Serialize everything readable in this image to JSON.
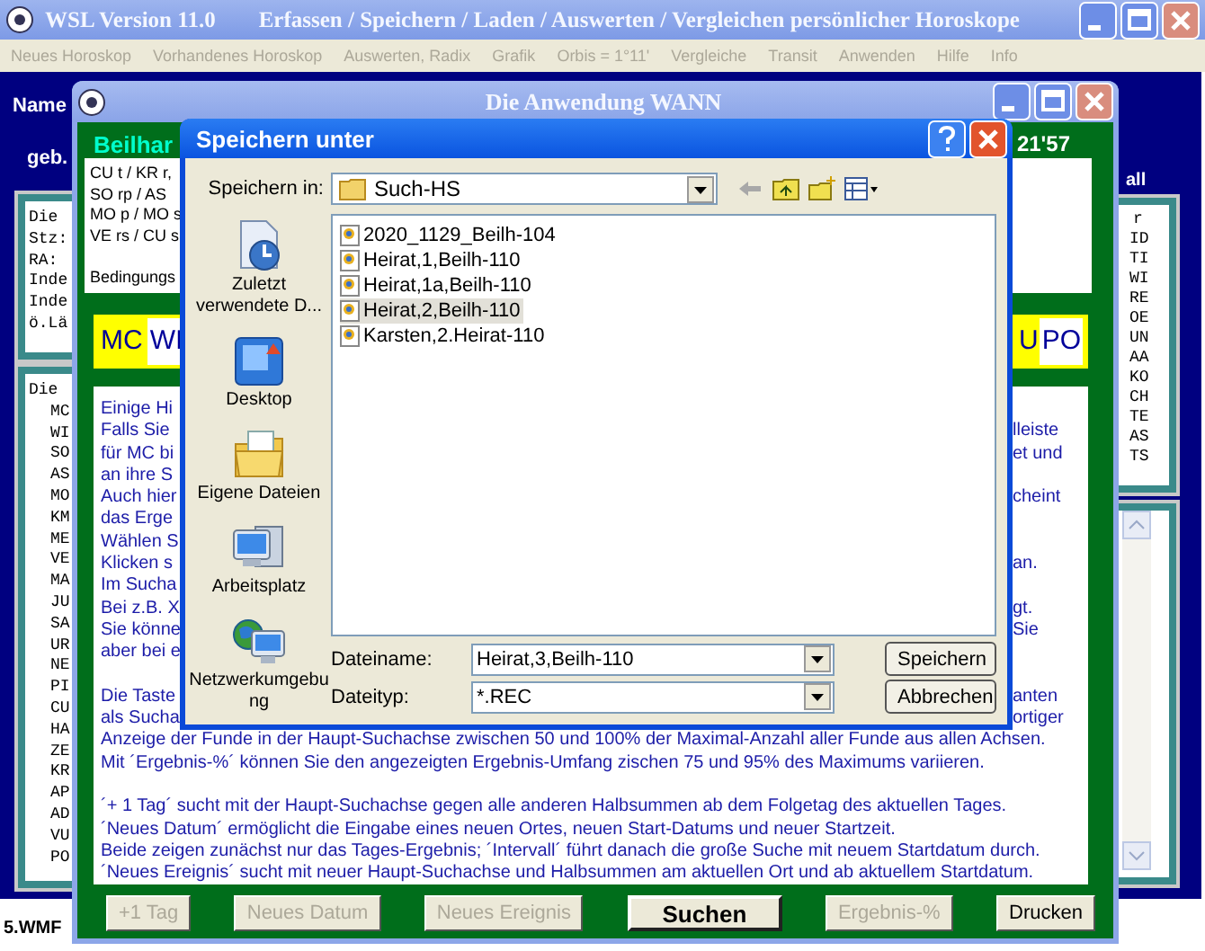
{
  "main_window": {
    "app_name": "WSL Version 11.0",
    "title": "Erfassen / Speichern / Laden / Auswerten / Vergleichen persönlicher Horoskope",
    "menu": [
      {
        "label": "Neues Horoskop",
        "disabled": true
      },
      {
        "label": "Vorhandenes Horoskop",
        "disabled": true
      },
      {
        "label": "Auswerten, Radix",
        "disabled": true
      },
      {
        "label": "Grafik",
        "disabled": true
      },
      {
        "label": "Orbis = 1°11'",
        "disabled": true
      },
      {
        "label": "Vergleiche",
        "disabled": true
      },
      {
        "label": "Transit",
        "disabled": true
      },
      {
        "label": "Anwenden",
        "disabled": true
      },
      {
        "label": "Hilfe",
        "disabled": true
      },
      {
        "label": "Info",
        "disabled": true
      }
    ],
    "name_label": "Name",
    "birth_label": "geb.",
    "left_panel_1": [
      "Die",
      "Stz:",
      "RA:",
      "Inde",
      "Inde",
      "ö.Lä"
    ],
    "left_panel_2": {
      "heading": "Die",
      "rows": [
        "MC",
        "WI",
        "SO",
        "AS",
        "MO",
        "KM",
        "ME",
        "VE",
        "MA",
        "JU",
        "SA",
        "UR",
        "NE",
        "PI",
        "CU",
        "HA",
        "ZE",
        "KR",
        "AP",
        "AD",
        "VU",
        "PO"
      ]
    },
    "right_label": "all",
    "right_panel": [
      "r",
      "ID",
      "TI",
      "WI",
      "RE",
      "OE",
      "UN",
      "AA",
      "KO",
      "CH",
      "TE",
      "AS",
      "TS"
    ],
    "footer_file": "5.WMF"
  },
  "wann_window": {
    "title": "Die Anwendung WANN",
    "name": "Beilhar",
    "time": "21'57",
    "conditions": [
      "CU t / KR r,",
      "SO rp / AS",
      "MO p / MO s",
      "VE rs / CU s"
    ],
    "conditions_footer": "Bedingungs",
    "axes_left": [
      {
        "label": "MC",
        "highlighted": false
      },
      {
        "label": "WI",
        "highlighted": true
      }
    ],
    "axes_right": [
      {
        "label": "U",
        "highlighted": false
      },
      {
        "label": "PO",
        "highlighted": true
      }
    ],
    "help_lines": [
      {
        "kind": "split",
        "left": "Einige Hi"
      },
      {
        "kind": "split",
        "left": "Falls Sie",
        "right": "lleiste"
      },
      {
        "kind": "split",
        "left": "für MC bi",
        "right": "et und"
      },
      {
        "kind": "split",
        "left": "an ihre S"
      },
      {
        "kind": "split",
        "left": "Auch hier",
        "right": "cheint"
      },
      {
        "kind": "split",
        "left": "das Erge"
      },
      {
        "kind": "split",
        "left": "Wählen S"
      },
      {
        "kind": "split",
        "left": "Klicken s",
        "right": "an."
      },
      {
        "kind": "split",
        "left": "Im Sucha"
      },
      {
        "kind": "split",
        "left": "Bei z.B. X",
        "right": "gt."
      },
      {
        "kind": "split",
        "left": "Sie könne",
        "right": "Sie"
      },
      {
        "kind": "split",
        "left": "aber bei e"
      },
      {
        "kind": "blank"
      },
      {
        "kind": "split",
        "left": "Die Taste",
        "right": "anten"
      },
      {
        "kind": "split",
        "left": "als Sucha",
        "right": "ortiger"
      },
      {
        "kind": "full",
        "text": "Anzeige der Funde in der Haupt-Suchachse zwischen 50 und 100% der Maximal-Anzahl aller Funde aus allen Achsen."
      },
      {
        "kind": "full",
        "text": "Mit ´Ergebnis-%´ können Sie den angezeigten Ergebnis-Umfang zischen 75 und 95% des Maximums variieren."
      },
      {
        "kind": "blank"
      },
      {
        "kind": "full",
        "text": "´+ 1 Tag´ sucht mit der Haupt-Suchachse gegen alle anderen Halbsummen ab dem Folgetag des aktuellen Tages."
      },
      {
        "kind": "full",
        "text": "´Neues Datum´ ermöglicht die Eingabe eines neuen Ortes, neuen Start-Datums und neuer Startzeit."
      },
      {
        "kind": "full",
        "text": "Beide zeigen zunächst nur das Tages-Ergebnis; ´Intervall´ führt danach die große Suche mit neuem Startdatum durch."
      },
      {
        "kind": "full",
        "text": "´Neues Ereignis´ sucht mit neuer Haupt-Suchachse und Halbsummen am aktuellen Ort und ab aktuellem Startdatum."
      }
    ],
    "buttons": [
      {
        "label": "+1 Tag",
        "disabled": true,
        "default": false
      },
      {
        "label": "Neues Datum",
        "disabled": true,
        "default": false
      },
      {
        "label": "Neues Ereignis",
        "disabled": true,
        "default": false
      },
      {
        "label": "Suchen",
        "disabled": false,
        "default": true
      },
      {
        "label": "Ergebnis-%",
        "disabled": true,
        "default": false
      },
      {
        "label": "Drucken",
        "disabled": false,
        "default": false
      }
    ]
  },
  "save_dialog": {
    "title": "Speichern unter",
    "location_label": "Speichern in:",
    "location": "Such-HS",
    "places": [
      {
        "kind": "recent",
        "label": "Zuletzt verwendete D..."
      },
      {
        "kind": "desktop",
        "label": "Desktop"
      },
      {
        "kind": "documents",
        "label": "Eigene Dateien"
      },
      {
        "kind": "computer",
        "label": "Arbeitsplatz"
      },
      {
        "kind": "network",
        "label": "Netzwerkumgebung"
      }
    ],
    "files": [
      {
        "name": "2020_1129_Beilh-104",
        "selected": false
      },
      {
        "name": "Heirat,1,Beilh-110",
        "selected": false
      },
      {
        "name": "Heirat,1a,Beilh-110",
        "selected": false
      },
      {
        "name": "Heirat,2,Beilh-110",
        "selected": true
      },
      {
        "name": "Karsten,2.Heirat-110",
        "selected": false
      }
    ],
    "filename_label": "Dateiname:",
    "filename": "Heirat,3,Beilh-110",
    "filetype_label": "Dateityp:",
    "filetype": "*.REC",
    "buttons": [
      "Speichern",
      "Abbrechen"
    ]
  }
}
